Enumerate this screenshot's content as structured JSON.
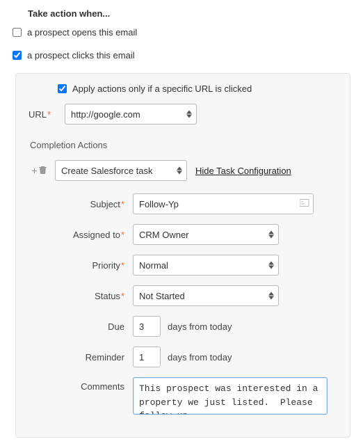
{
  "heading": "Take action when...",
  "triggers": {
    "opens": {
      "label": "a prospect opens this email",
      "checked": false
    },
    "clicks": {
      "label": "a prospect clicks this email",
      "checked": true
    }
  },
  "panel": {
    "apply_url": {
      "label": "Apply actions only if a specific URL is clicked",
      "checked": true
    },
    "url": {
      "label": "URL",
      "value": "http://google.com"
    },
    "completion_heading": "Completion Actions",
    "action_select": "Create Salesforce task",
    "hide_link": "Hide Task Configuration",
    "fields": {
      "subject": {
        "label": "Subject",
        "value": "Follow-Yp"
      },
      "assigned_to": {
        "label": "Assigned to",
        "value": "CRM Owner"
      },
      "priority": {
        "label": "Priority",
        "value": "Normal"
      },
      "status": {
        "label": "Status",
        "value": "Not Started"
      },
      "due": {
        "label": "Due",
        "value": "3",
        "suffix": "days from today"
      },
      "reminder": {
        "label": "Reminder",
        "value": "1",
        "suffix": "days from today"
      },
      "comments": {
        "label": "Comments",
        "value": "This prospect was interested in a property we just listed.  Please follow-up."
      }
    }
  }
}
